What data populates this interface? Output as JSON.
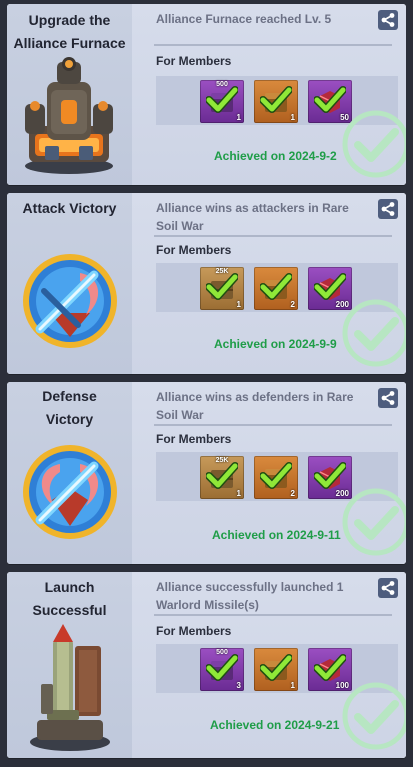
{
  "cards": [
    {
      "title": "Upgrade the\nAlliance Furnace",
      "description": "Alliance Furnace reached Lv. 5",
      "section_label": "For Members",
      "achieved": "Achieved on 2024-9-2",
      "icon": "alliance-furnace-icon",
      "rewards": [
        {
          "top": "500",
          "qty": "1",
          "icon": "purple-chest-icon"
        },
        {
          "top": "",
          "qty": "1",
          "icon": "orange-chest-icon"
        },
        {
          "top": "",
          "qty": "50",
          "icon": "gem-box-icon"
        }
      ]
    },
    {
      "title": "Attack Victory",
      "description": "Alliance wins as attackers in Rare Soil War",
      "section_label": "For Members",
      "achieved": "Achieved on 2024-9-9",
      "icon": "attack-victory-emblem-icon",
      "rewards": [
        {
          "top": "25K",
          "qty": "1",
          "icon": "resource-crate-icon"
        },
        {
          "top": "",
          "qty": "2",
          "icon": "orange-chest-icon"
        },
        {
          "top": "",
          "qty": "200",
          "icon": "gem-box-icon"
        }
      ]
    },
    {
      "title": "Defense\nVictory",
      "description": "Alliance wins as defenders in Rare Soil War",
      "section_label": "For Members",
      "achieved": "Achieved on 2024-9-11",
      "icon": "defense-victory-emblem-icon",
      "rewards": [
        {
          "top": "25K",
          "qty": "1",
          "icon": "resource-crate-icon"
        },
        {
          "top": "",
          "qty": "2",
          "icon": "orange-chest-icon"
        },
        {
          "top": "",
          "qty": "200",
          "icon": "gem-box-icon"
        }
      ]
    },
    {
      "title": "Launch\nSuccessful",
      "description": "Alliance successfully launched 1 Warlord Missile(s)",
      "section_label": "For Members",
      "achieved": "Achieved on 2024-9-21",
      "icon": "warlord-missile-icon",
      "rewards": [
        {
          "top": "500",
          "qty": "3",
          "icon": "purple-chest-icon"
        },
        {
          "top": "",
          "qty": "1",
          "icon": "orange-chest-icon"
        },
        {
          "top": "",
          "qty": "100",
          "icon": "gem-box-icon"
        }
      ]
    }
  ],
  "colors": {
    "accent_green": "#1f9d48",
    "share_button": "#4e5d7e"
  }
}
